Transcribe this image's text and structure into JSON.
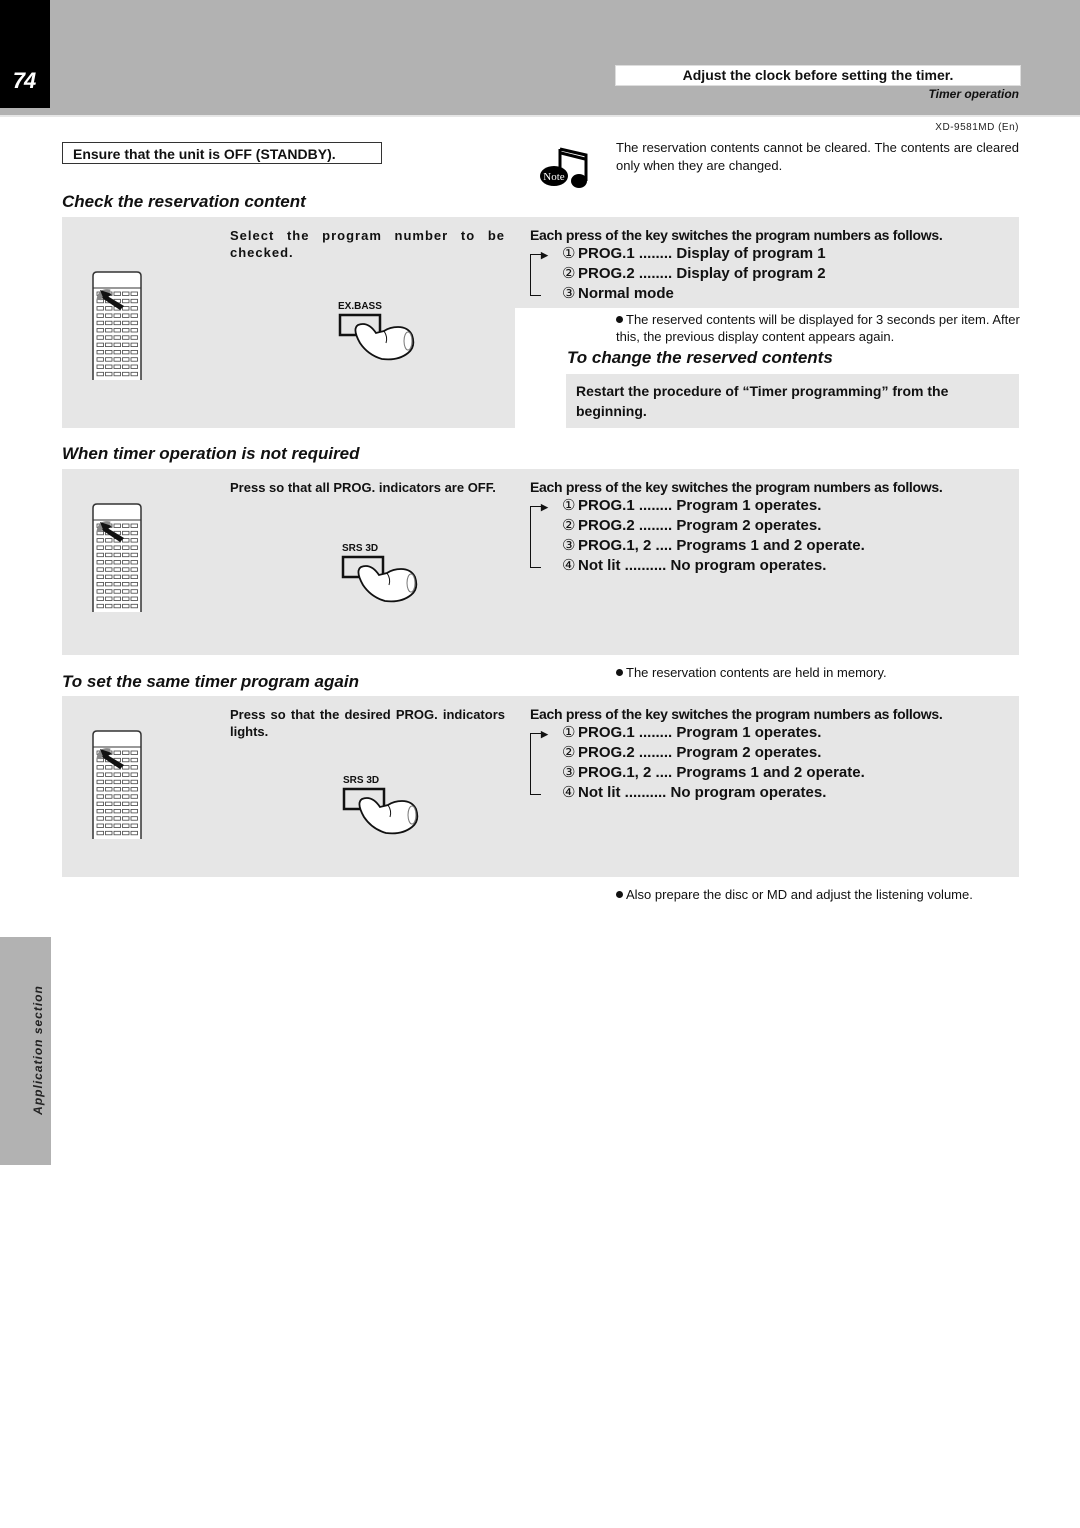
{
  "header": {
    "page_number": "74",
    "banner": "Adjust the clock before setting the timer.",
    "subtitle": "Timer operation",
    "model_code": "XD-9581MD (En)"
  },
  "prerequisite": "Ensure that the unit is OFF (STANDBY).",
  "note": {
    "icon_label": "Note",
    "text": "The reservation contents cannot be cleared. The contents are cleared only when they are changed."
  },
  "sections": {
    "check": {
      "title": "Check the reservation content",
      "step": "Select the program number to be checked.",
      "button_label": "EX.BASS",
      "sequence_heading": "Each press of the key switches the program numbers as follows.",
      "sequence": [
        {
          "num": "①",
          "text": "PROG.1 ........ Display of program 1"
        },
        {
          "num": "②",
          "text": "PROG.2 ........ Display of program 2"
        },
        {
          "num": "③",
          "text": "Normal mode"
        }
      ],
      "bullet": "The reserved contents will be displayed for 3 seconds per item. After this, the previous display content appears again.",
      "sub_title": "To change the reserved contents",
      "sub_text": "Restart the procedure of “Timer programming” from the beginning."
    },
    "not_required": {
      "title": "When timer operation is not required",
      "step": "Press so that all PROG. indicators are OFF.",
      "button_label": "SRS 3D",
      "sequence_heading": "Each press of the key switches the program numbers as follows.",
      "sequence": [
        {
          "num": "①",
          "text": "PROG.1 ........ Program 1 operates."
        },
        {
          "num": "②",
          "text": "PROG.2 ........ Program 2 operates."
        },
        {
          "num": "③",
          "text": "PROG.1, 2 .... Programs 1 and 2 operate."
        },
        {
          "num": "④",
          "text": "Not lit .......... No program operates."
        }
      ],
      "bullet": "The reservation contents are held in memory."
    },
    "set_again": {
      "title": "To set the same timer program again",
      "step": "Press so that the desired PROG. indicators lights.",
      "button_label": "SRS 3D",
      "sequence_heading": "Each press of the key switches the program numbers as follows.",
      "sequence": [
        {
          "num": "①",
          "text": "PROG.1 ........ Program 1 operates."
        },
        {
          "num": "②",
          "text": "PROG.2 ........ Program 2 operates."
        },
        {
          "num": "③",
          "text": "PROG.1, 2 .... Programs 1 and 2 operate."
        },
        {
          "num": "④",
          "text": "Not lit .......... No program operates."
        }
      ],
      "bullet": "Also prepare the disc or MD and adjust the listening volume."
    }
  },
  "side_tab": "Application section",
  "colors": {
    "band_gray": "#b2b2b2",
    "panel_gray": "#e6e6e6",
    "ink": "#111111"
  }
}
